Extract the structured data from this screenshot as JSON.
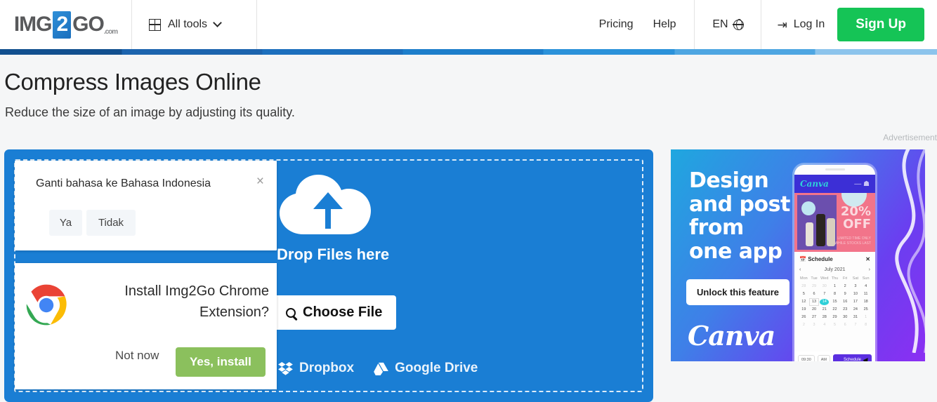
{
  "header": {
    "logo": {
      "part1": "IMG",
      "part2": "2",
      "part3": "GO",
      "suffix": ".com"
    },
    "all_tools_label": "All tools",
    "links": [
      {
        "label": "Pricing",
        "name": "pricing"
      },
      {
        "label": "Help",
        "name": "help"
      }
    ],
    "language_code": "EN",
    "login_label": "Log In",
    "signup_label": "Sign Up",
    "signup_color": "#15c456"
  },
  "page": {
    "title": "Compress Images Online",
    "subtitle": "Reduce the size of an image by adjusting its quality."
  },
  "ad": {
    "label": "Advertisement",
    "headline": "Design\nand post\nfrom\none app",
    "cta_label": "Unlock this feature",
    "brand": "Canva",
    "phone": {
      "app_name": "Canva",
      "promo_percent": "20%",
      "promo_word": "OFF",
      "promo_sub": "LIMITED TIME ONLY\nWHILE STOCKS LAST",
      "schedule_label": "Schedule",
      "month_label": "July 2021",
      "dow": [
        "Mon",
        "Tue",
        "Wed",
        "Thu",
        "Fri",
        "Sat",
        "Sun"
      ],
      "weeks": [
        [
          "28",
          "29",
          "30",
          "1",
          "2",
          "3",
          "4"
        ],
        [
          "5",
          "6",
          "7",
          "8",
          "9",
          "10",
          "11"
        ],
        [
          "12",
          "13",
          "14",
          "15",
          "16",
          "17",
          "18"
        ],
        [
          "19",
          "20",
          "21",
          "22",
          "23",
          "24",
          "25"
        ],
        [
          "26",
          "27",
          "28",
          "29",
          "30",
          "31",
          "1"
        ],
        [
          "2",
          "3",
          "4",
          "5",
          "6",
          "7",
          "8"
        ]
      ],
      "selected_day": "14",
      "outlined_day": "13",
      "time_value": "09:30",
      "meridiem_value": "AM",
      "schedule_button": "Schedule"
    }
  },
  "dropzone": {
    "drop_text": "Drop Files here",
    "choose_file_label": "Choose File",
    "cloud_sources": [
      {
        "label": "Dropbox",
        "name": "dropbox"
      },
      {
        "label": "Google Drive",
        "name": "google-drive"
      }
    ],
    "background_color": "#1a7ed4"
  },
  "language_popup": {
    "title": "Ganti bahasa ke Bahasa Indonesia",
    "close_label": "×",
    "yes_label": "Ya",
    "no_label": "Tidak"
  },
  "extension_popup": {
    "title": "Install Img2Go Chrome Extension?",
    "decline_label": "Not now",
    "accept_label": "Yes, install",
    "accept_color": "#8bc05d"
  }
}
